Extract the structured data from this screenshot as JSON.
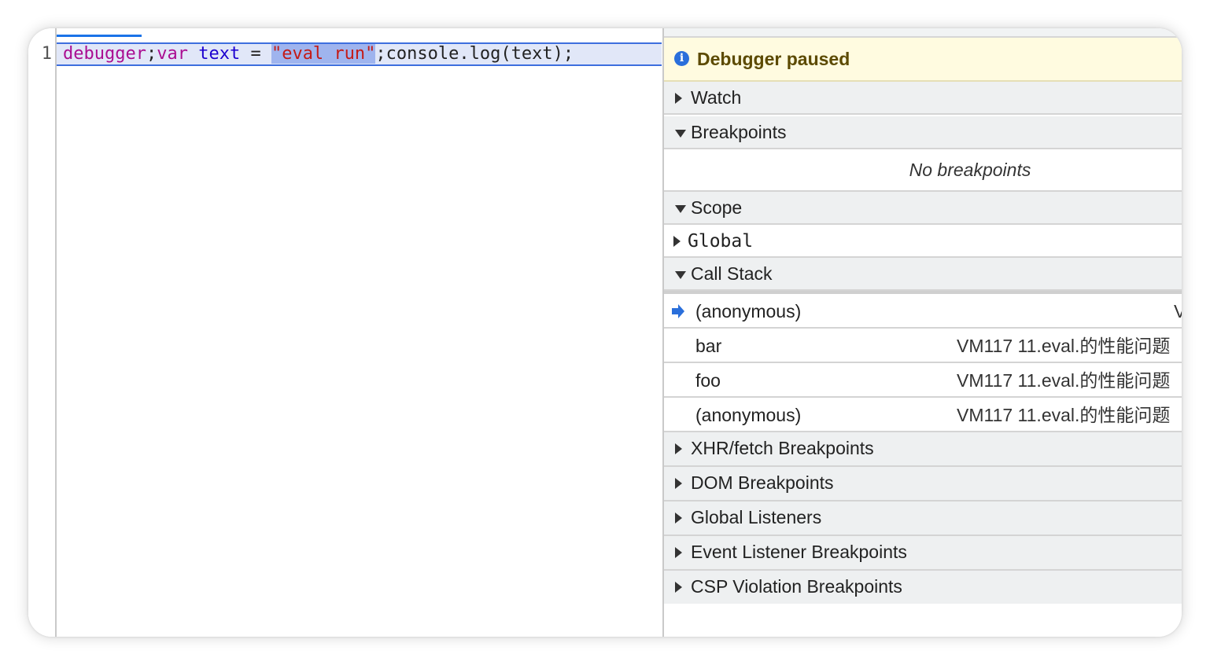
{
  "editor": {
    "line_number": "1",
    "code": {
      "tok1": "debugger",
      "tok2": ";",
      "tok3": "var",
      "tok4": " text ",
      "tok5": "= ",
      "tok6": "\"eval run\"",
      "tok7": ";console.log(text);"
    }
  },
  "sidebar": {
    "paused_banner": "Debugger paused",
    "sections": {
      "watch": "Watch",
      "breakpoints": "Breakpoints",
      "no_breakpoints": "No breakpoints",
      "scope": "Scope",
      "global": "Global",
      "call_stack": "Call Stack",
      "xhr": "XHR/fetch Breakpoints",
      "dom": "DOM Breakpoints",
      "global_listeners": "Global Listeners",
      "event_listener": "Event Listener Breakpoints",
      "csp": "CSP Violation Breakpoints"
    },
    "call_stack": [
      {
        "name": "(anonymous)",
        "location": "V"
      },
      {
        "name": "bar",
        "location": "VM117 11.eval.的性能问题"
      },
      {
        "name": "foo",
        "location": "VM117 11.eval.的性能问题"
      },
      {
        "name": "(anonymous)",
        "location": "VM117 11.eval.的性能问题"
      }
    ]
  },
  "colors": {
    "current_frame_arrow": "#2a6fdb",
    "info_icon": "#2a6fdb",
    "paused_banner_bg": "#fffbe0",
    "selection_highlight": "#e1e7f8"
  }
}
